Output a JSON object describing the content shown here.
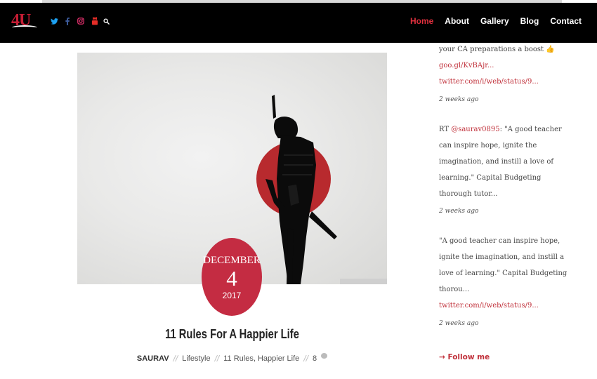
{
  "logo": {
    "text": "4U"
  },
  "social": {
    "icons": [
      "twitter-icon",
      "facebook-icon",
      "instagram-icon",
      "youtube-icon",
      "search-icon"
    ],
    "colors": {
      "twitter": "#1da1f2",
      "facebook": "#3b5998",
      "instagram": "#e1306c",
      "youtube": "#e52d27",
      "search": "#ffffff"
    }
  },
  "nav": {
    "items": [
      {
        "label": "Home",
        "active": true
      },
      {
        "label": "About",
        "active": false
      },
      {
        "label": "Gallery",
        "active": false
      },
      {
        "label": "Blog",
        "active": false
      },
      {
        "label": "Contact",
        "active": false
      }
    ]
  },
  "post": {
    "date": {
      "month": "DECEMBER",
      "day": "4",
      "year": "2017"
    },
    "title": "11 Rules For A Happier Life",
    "author": "SAURAV",
    "category": "Lifestyle",
    "tags": "11 Rules, Happier Life",
    "comments": "8"
  },
  "sidebar": {
    "tweet1": {
      "line1": "your CA preparations a boost 👍",
      "link1": "goo.gl/KvBAjr...",
      "link2": "twitter.com/i/web/status/9...",
      "time": "2 weeks ago"
    },
    "tweet2": {
      "prefix": "RT ",
      "mention": "@saurav0895",
      "line1_rest": ": \"A good teacher",
      "line2": "can inspire hope, ignite the",
      "line3": "imagination, and instill a love of",
      "line4": "learning.\" Capital Budgeting",
      "line5": "thorough tutor...",
      "time": "2 weeks ago"
    },
    "tweet3": {
      "line1": "\"A good teacher can inspire hope,",
      "line2": "ignite the imagination, and instill a",
      "line3": "love of learning.\" Capital Budgeting",
      "line4": "thorou...",
      "link1": "twitter.com/i/web/status/9...",
      "time": "2 weeks ago"
    },
    "follow": "→ Follow me"
  },
  "colors": {
    "accent": "#c42c42",
    "header_bg": "#000000",
    "link": "#c0303a"
  }
}
